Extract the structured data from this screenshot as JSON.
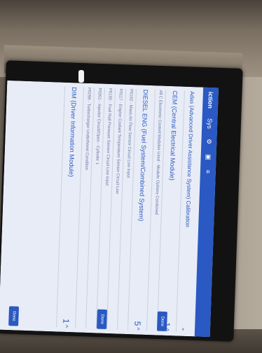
{
  "appbar": {
    "title": "iction",
    "tab_sys": "Sys"
  },
  "status": {
    "time": ""
  },
  "rows": [
    {
      "kind": "header",
      "label": "Adas (Advanced Driver Assistance System) Calibration",
      "count": ""
    },
    {
      "kind": "module",
      "label": "CEM (Central Electrical Module)",
      "count": "1"
    },
    {
      "kind": "sub",
      "label": "All C Electronic Control Modules Used - Module Options Combined"
    },
    {
      "kind": "module",
      "label": "DIESEL ENG (Fuel System/Combined System)",
      "count": "5"
    },
    {
      "kind": "sub",
      "label": "P0102 - Mass Air Flow Sensor Circuit Low Input"
    },
    {
      "kind": "sub",
      "label": "P0117 - Engine Coolant Temperature Sensor Circuit Low"
    },
    {
      "kind": "sub",
      "label": "P0192 - Fuel Rail Pressure Sensor Circuit Low Input"
    },
    {
      "kind": "sub",
      "label": "P0201 - Injector Circuit/Open - Cylinder 1"
    },
    {
      "kind": "sub",
      "label": "P0299 - Turbocharger Underboost Condition"
    },
    {
      "kind": "module",
      "label": "DIM (Driver Information Module)",
      "count": "1"
    }
  ],
  "buttons": {
    "done": "Done"
  }
}
